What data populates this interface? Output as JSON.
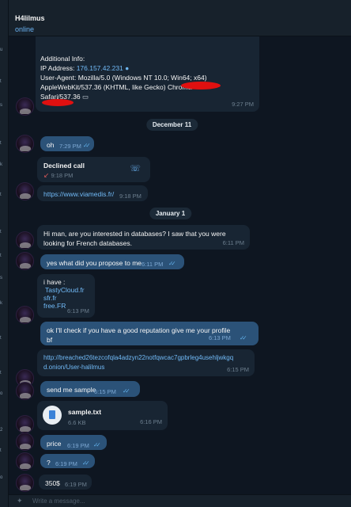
{
  "header": {
    "title": "H4lilmus",
    "status": "online"
  },
  "composer": {
    "placeholder": "Write a message..."
  },
  "info": {
    "heading": "Additional Info:",
    "ip_label": "IP Address: ",
    "ip": "176.157.42.231",
    "ua1": "User-Agent: Mozilla/5.0 (Windows NT 10.0; Win64; x64)",
    "ua2": "AppleWebKit/537.36 (KHTML, like Gecko) Chrome/",
    "ua3": "Safari/537.36",
    "time": "9:27 PM"
  },
  "dates": {
    "d1": "December 11",
    "d2": "January 1"
  },
  "messages": {
    "m1": {
      "text": "oh",
      "time": "7:29 PM"
    },
    "call": {
      "title": "Declined call",
      "time": "9:18 PM"
    },
    "m2": {
      "text": "https://www.viamedis.fr/",
      "time": "9:18 PM"
    },
    "m3": {
      "text": "Hi man, are you interested in databases? I saw that you were looking for French databases.",
      "time": "6:11 PM"
    },
    "m4": {
      "text": "yes what did you propose to me",
      "time": "6:11 PM"
    },
    "m5": {
      "l1": "i have :",
      "l2": "TastyCloud.fr",
      "l3": "sfr.fr",
      "l4": "free.FR",
      "time": "6:13 PM"
    },
    "m6": {
      "text": "ok I'll check if you have a good reputation give me your profile bf",
      "time": "6:13 PM"
    },
    "m7": {
      "l1": "http://breached26tezcofqla4adzyn22notfqwcac7gpbrleg4usehljwkgq",
      "l2": "d.onion/User-halilmus",
      "time": "6:15 PM"
    },
    "m8": {
      "text": "send me sample",
      "time": "6:15 PM"
    },
    "file": {
      "name": "sample.txt",
      "size": "6.6 KB",
      "time": "6:16 PM"
    },
    "m9": {
      "text": "price",
      "time": "6:19 PM"
    },
    "m10": {
      "text": "?",
      "time": "6:19 PM"
    },
    "m11": {
      "text": "350$",
      "time": "6:19 PM"
    }
  },
  "colors": {
    "background": "#0e1621",
    "incoming": "#182533",
    "outgoing": "#2b5278",
    "link": "#71baf7",
    "accent": "#6ab2f2",
    "redaction": "#e01010"
  }
}
